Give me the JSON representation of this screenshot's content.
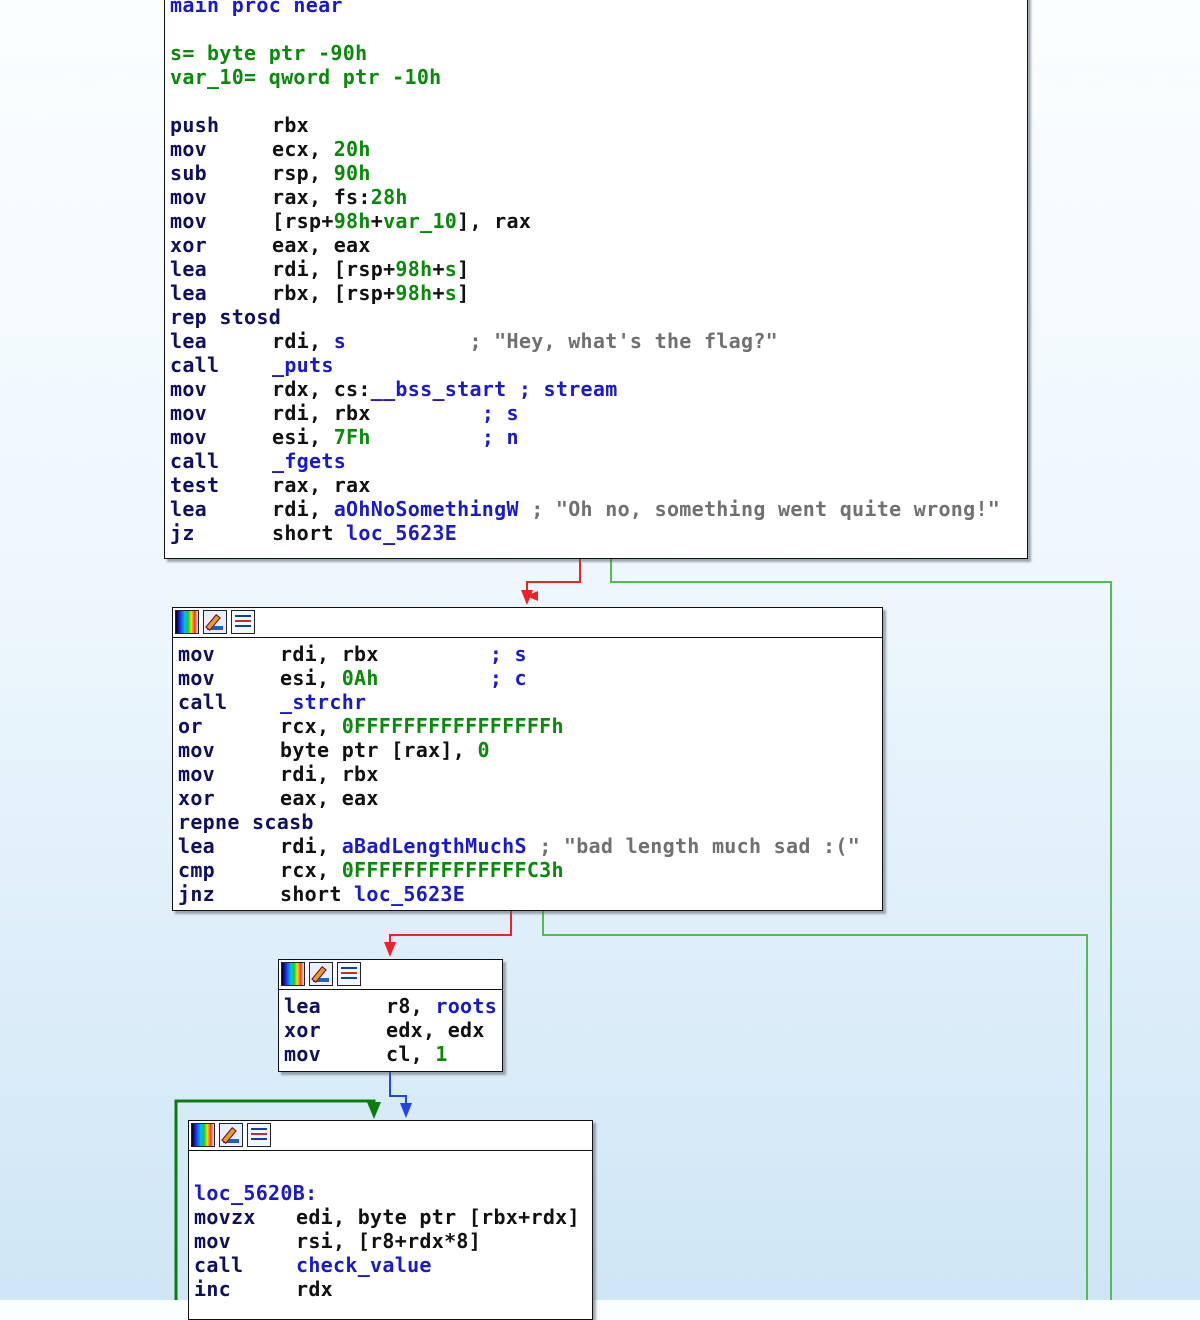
{
  "colors": {
    "edge_true": "#ee2222",
    "edge_false": "#55bb55",
    "edge_uncond": "#2244ee",
    "edge_loop": "#0c7d0c"
  },
  "block1": {
    "lines": [
      {
        "type": "raw",
        "cls": "lbl",
        "text": "main proc near"
      },
      {
        "type": "blank"
      },
      {
        "type": "raw",
        "cls": "var",
        "text": "s= byte ptr -90h"
      },
      {
        "type": "raw",
        "cls": "var",
        "text": "var_10= qword ptr -10h"
      },
      {
        "type": "blank"
      },
      {
        "type": "ins",
        "m": "push",
        "parts": [
          [
            "op",
            "rbx"
          ]
        ]
      },
      {
        "type": "ins",
        "m": "mov",
        "parts": [
          [
            "op",
            "ecx, "
          ],
          [
            "num",
            "20h"
          ]
        ]
      },
      {
        "type": "ins",
        "m": "sub",
        "parts": [
          [
            "op",
            "rsp, "
          ],
          [
            "num",
            "90h"
          ]
        ]
      },
      {
        "type": "ins",
        "m": "mov",
        "parts": [
          [
            "op",
            "rax, fs:"
          ],
          [
            "num",
            "28h"
          ]
        ]
      },
      {
        "type": "ins",
        "m": "mov",
        "parts": [
          [
            "op",
            "[rsp+"
          ],
          [
            "num",
            "98h"
          ],
          [
            "op",
            "+"
          ],
          [
            "var",
            "var_10"
          ],
          [
            "op",
            "], rax"
          ]
        ]
      },
      {
        "type": "ins",
        "m": "xor",
        "parts": [
          [
            "op",
            "eax, eax"
          ]
        ]
      },
      {
        "type": "ins",
        "m": "lea",
        "parts": [
          [
            "op",
            "rdi, [rsp+"
          ],
          [
            "num",
            "98h"
          ],
          [
            "op",
            "+"
          ],
          [
            "var",
            "s"
          ],
          [
            "op",
            "]"
          ]
        ]
      },
      {
        "type": "ins",
        "m": "lea",
        "parts": [
          [
            "op",
            "rbx, [rsp+"
          ],
          [
            "num",
            "98h"
          ],
          [
            "op",
            "+"
          ],
          [
            "var",
            "s"
          ],
          [
            "op",
            "]"
          ]
        ]
      },
      {
        "type": "ins",
        "m": "rep stosd",
        "parts": []
      },
      {
        "type": "ins",
        "m": "lea",
        "parts": [
          [
            "op",
            "rdi, "
          ],
          [
            "lbl",
            "s"
          ],
          [
            "op",
            "          "
          ],
          [
            "cmt",
            "; \"Hey, what's the flag?\""
          ]
        ]
      },
      {
        "type": "ins",
        "m": "call",
        "parts": [
          [
            "fn",
            "_puts"
          ]
        ]
      },
      {
        "type": "ins",
        "m": "mov",
        "parts": [
          [
            "op",
            "rdx, cs:"
          ],
          [
            "lbl",
            "__bss_start"
          ],
          [
            "op",
            " "
          ],
          [
            "cmtb",
            "; stream"
          ]
        ]
      },
      {
        "type": "ins",
        "m": "mov",
        "parts": [
          [
            "op",
            "rdi, rbx         "
          ],
          [
            "cmtb",
            "; s"
          ]
        ]
      },
      {
        "type": "ins",
        "m": "mov",
        "parts": [
          [
            "op",
            "esi, "
          ],
          [
            "num",
            "7Fh"
          ],
          [
            "op",
            "         "
          ],
          [
            "cmtb",
            "; n"
          ]
        ]
      },
      {
        "type": "ins",
        "m": "call",
        "parts": [
          [
            "fn",
            "_fgets"
          ]
        ]
      },
      {
        "type": "ins",
        "m": "test",
        "parts": [
          [
            "op",
            "rax, rax"
          ]
        ]
      },
      {
        "type": "ins",
        "m": "lea",
        "parts": [
          [
            "op",
            "rdi, "
          ],
          [
            "lbl",
            "aOhNoSomethingW"
          ],
          [
            "op",
            " "
          ],
          [
            "cmt",
            "; \"Oh no, something went quite wrong!\""
          ]
        ]
      },
      {
        "type": "ins",
        "m": "jz",
        "parts": [
          [
            "op",
            "short "
          ],
          [
            "lbl",
            "loc_5623E"
          ]
        ]
      }
    ]
  },
  "block2": {
    "lines": [
      {
        "type": "ins",
        "m": "mov",
        "parts": [
          [
            "op",
            "rdi, rbx         "
          ],
          [
            "cmtb",
            "; s"
          ]
        ]
      },
      {
        "type": "ins",
        "m": "mov",
        "parts": [
          [
            "op",
            "esi, "
          ],
          [
            "num",
            "0Ah"
          ],
          [
            "op",
            "         "
          ],
          [
            "cmtb",
            "; c"
          ]
        ]
      },
      {
        "type": "ins",
        "m": "call",
        "parts": [
          [
            "fn",
            "_strchr"
          ]
        ]
      },
      {
        "type": "ins",
        "m": "or",
        "parts": [
          [
            "op",
            "rcx, "
          ],
          [
            "num",
            "0FFFFFFFFFFFFFFFFh"
          ]
        ]
      },
      {
        "type": "ins",
        "m": "mov",
        "parts": [
          [
            "op",
            "byte ptr [rax], "
          ],
          [
            "num",
            "0"
          ]
        ]
      },
      {
        "type": "ins",
        "m": "mov",
        "parts": [
          [
            "op",
            "rdi, rbx"
          ]
        ]
      },
      {
        "type": "ins",
        "m": "xor",
        "parts": [
          [
            "op",
            "eax, eax"
          ]
        ]
      },
      {
        "type": "ins",
        "m": "repne scasb",
        "parts": []
      },
      {
        "type": "ins",
        "m": "lea",
        "parts": [
          [
            "op",
            "rdi, "
          ],
          [
            "lbl",
            "aBadLengthMuchS"
          ],
          [
            "op",
            " "
          ],
          [
            "cmt",
            "; \"bad length much sad :(\""
          ]
        ]
      },
      {
        "type": "ins",
        "m": "cmp",
        "parts": [
          [
            "op",
            "rcx, "
          ],
          [
            "num",
            "0FFFFFFFFFFFFFFC3h"
          ]
        ]
      },
      {
        "type": "ins",
        "m": "jnz",
        "parts": [
          [
            "op",
            "short "
          ],
          [
            "lbl",
            "loc_5623E"
          ]
        ]
      }
    ]
  },
  "block3": {
    "lines": [
      {
        "type": "ins",
        "m": "lea",
        "parts": [
          [
            "op",
            "r8, "
          ],
          [
            "lbl",
            "roots"
          ]
        ]
      },
      {
        "type": "ins",
        "m": "xor",
        "parts": [
          [
            "op",
            "edx, edx"
          ]
        ]
      },
      {
        "type": "ins",
        "m": "mov",
        "parts": [
          [
            "op",
            "cl, "
          ],
          [
            "num",
            "1"
          ]
        ]
      }
    ]
  },
  "block4": {
    "lines": [
      {
        "type": "blank"
      },
      {
        "type": "raw",
        "cls": "lbl",
        "text": "loc_5620B:"
      },
      {
        "type": "ins",
        "m": "movzx",
        "parts": [
          [
            "op",
            "edi, byte ptr [rbx+rdx]"
          ]
        ]
      },
      {
        "type": "ins",
        "m": "mov",
        "parts": [
          [
            "op",
            "rsi, [r8+rdx*8]"
          ]
        ]
      },
      {
        "type": "ins",
        "m": "call",
        "parts": [
          [
            "fn",
            "check_value"
          ]
        ]
      },
      {
        "type": "ins",
        "m": "inc",
        "parts": [
          [
            "op",
            "rdx"
          ]
        ]
      }
    ]
  }
}
